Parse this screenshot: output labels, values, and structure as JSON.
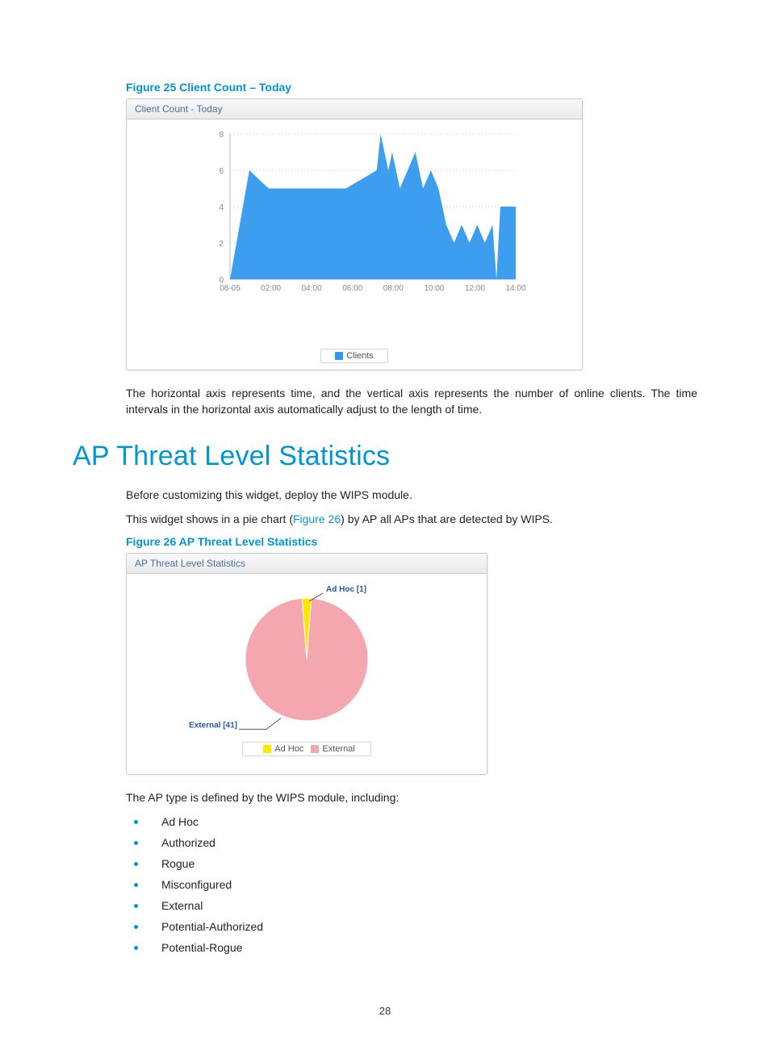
{
  "figure25": {
    "caption": "Figure 25 Client Count – Today",
    "card_title": "Client Count - Today",
    "legend_label": "Clients"
  },
  "paragraph_after_fig25": "The horizontal axis represents time, and the vertical axis represents the number of online clients. The time intervals in the horizontal axis automatically adjust to the length of time.",
  "section_title": "AP Threat Level Statistics",
  "threat_intro_1": "Before customizing this widget, deploy the WIPS module.",
  "threat_intro_2_pre": "This widget shows in a pie chart (",
  "threat_intro_2_link": "Figure 26",
  "threat_intro_2_post": ") by AP all APs that are detected by WIPS.",
  "figure26": {
    "caption": "Figure 26 AP Threat Level Statistics",
    "card_title": "AP Threat Level Statistics",
    "legend_adhoc": "Ad Hoc",
    "legend_external": "External"
  },
  "ap_type_intro": "The AP type is defined by the WIPS module, including:",
  "ap_types": [
    "Ad Hoc",
    "Authorized",
    "Rogue",
    "Misconfigured",
    "External",
    "Potential-Authorized",
    "Potential-Rogue"
  ],
  "page_number": "28",
  "chart_data": [
    {
      "type": "area",
      "title": "Client Count - Today",
      "xlabel": "",
      "ylabel": "",
      "ylim": [
        0,
        8
      ],
      "y_ticks": [
        0,
        2,
        4,
        6,
        8
      ],
      "x_ticks": [
        "08-05",
        "02:00",
        "04:00",
        "06:00",
        "08:00",
        "10:00",
        "12:00",
        "14:00"
      ],
      "series": [
        {
          "name": "Clients",
          "color": "#3399ee",
          "x": [
            0,
            0.5,
            1,
            2,
            3,
            3.8,
            3.9,
            4.1,
            4.2,
            4.4,
            4.6,
            4.8,
            5.0,
            5.2,
            5.4,
            5.6,
            5.8,
            6.0,
            6.2,
            6.4,
            6.6,
            6.8,
            6.9,
            7.0,
            7.4
          ],
          "y": [
            0,
            6,
            5,
            5,
            5,
            6,
            8,
            6,
            7,
            5,
            6,
            7,
            5,
            6,
            5,
            3,
            2,
            3,
            2,
            3,
            2,
            3,
            0,
            4,
            4
          ]
        }
      ],
      "legend": [
        "Clients"
      ]
    },
    {
      "type": "pie",
      "title": "AP Threat Level Statistics",
      "series": [
        {
          "name": "Ad Hoc",
          "value": 1,
          "color": "#ffe600",
          "callout": "Ad Hoc [1]"
        },
        {
          "name": "External",
          "value": 41,
          "color": "#f5a7af",
          "callout": "External [41]"
        }
      ],
      "legend": [
        "Ad Hoc",
        "External"
      ]
    }
  ]
}
